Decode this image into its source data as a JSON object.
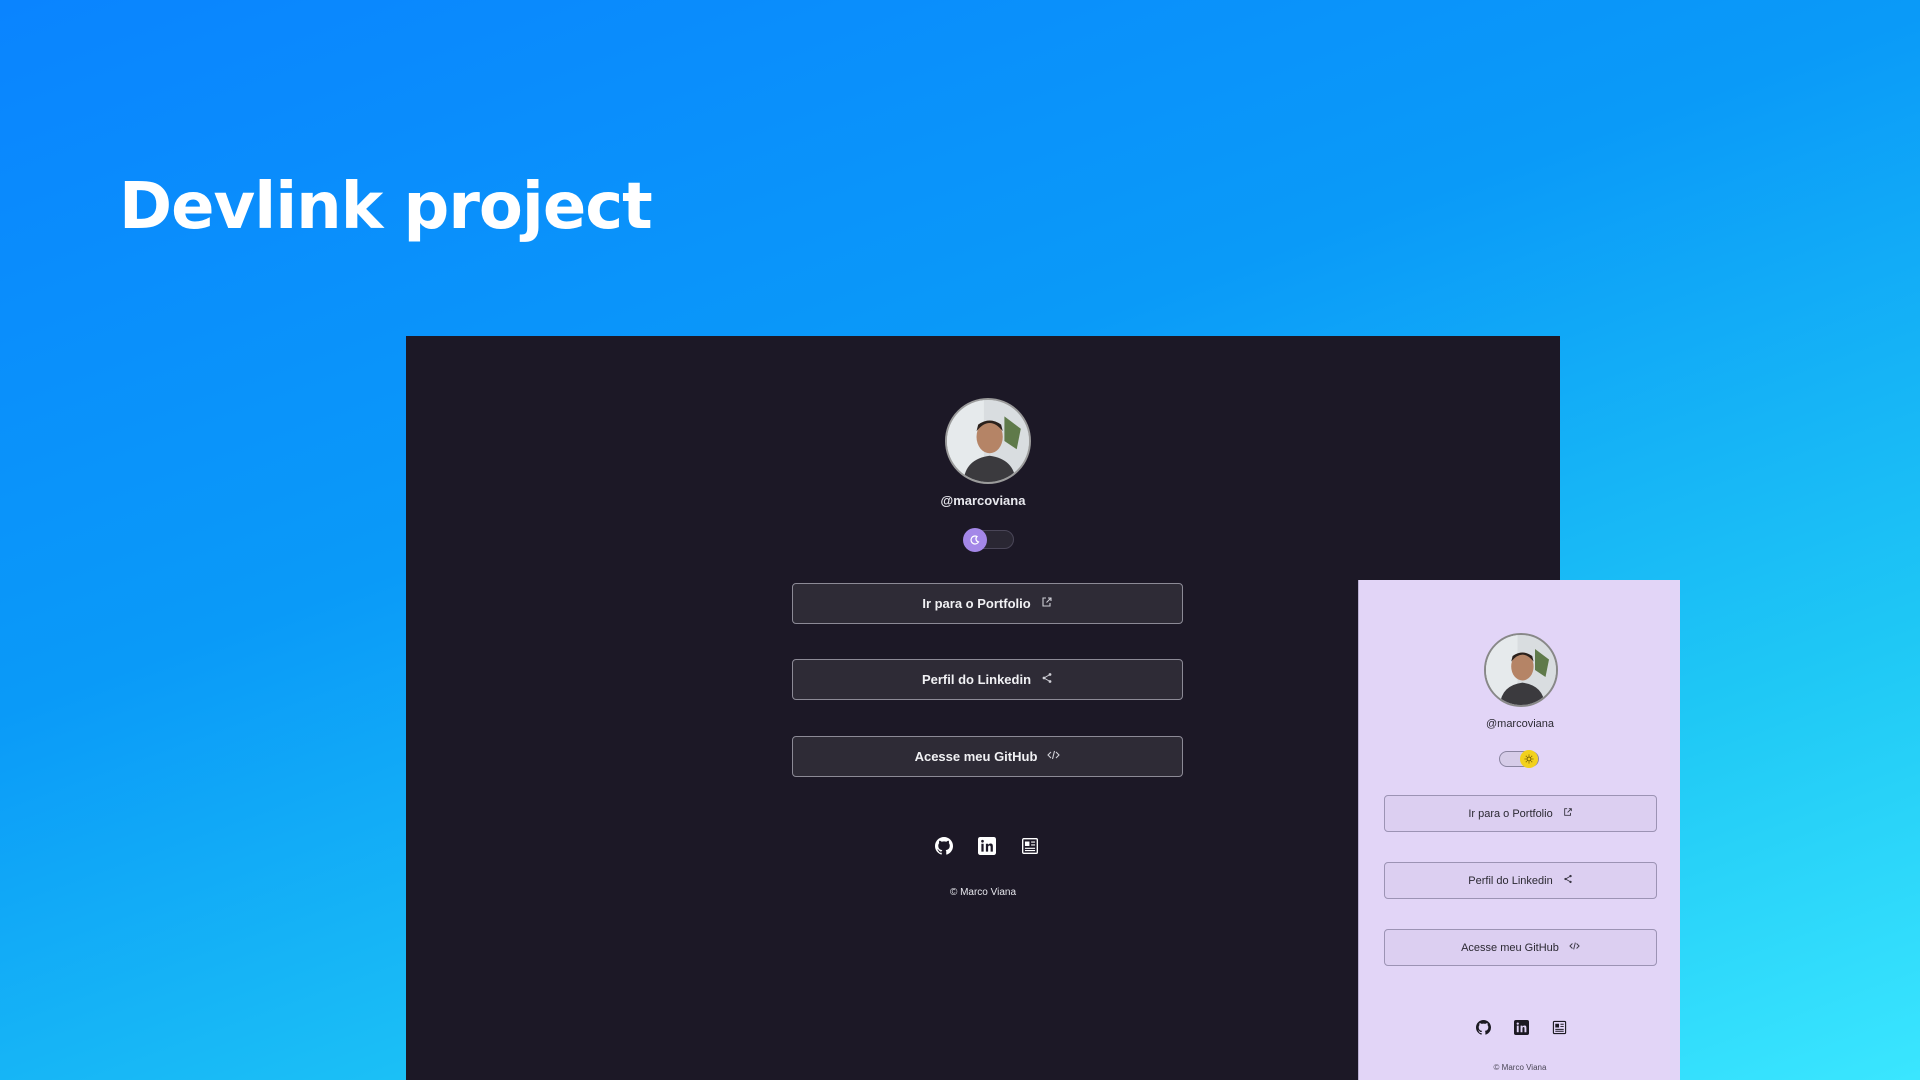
{
  "title": "Devlink project",
  "dark_preview": {
    "handle": "@marcoviana",
    "theme_toggle": "dark",
    "buttons": [
      {
        "label": "Ir para o Portfolio",
        "icon": "external-link-icon"
      },
      {
        "label": "Perfil do Linkedin",
        "icon": "share-icon"
      },
      {
        "label": "Acesse meu GitHub",
        "icon": "code-icon"
      }
    ],
    "social_icons": [
      "github-icon",
      "linkedin-icon",
      "resume-icon"
    ],
    "footer": "© Marco Viana"
  },
  "light_preview": {
    "handle": "@marcoviana",
    "theme_toggle": "light",
    "buttons": [
      {
        "label": "Ir para o Portfolio",
        "icon": "external-link-icon"
      },
      {
        "label": "Perfil do Linkedin",
        "icon": "share-icon"
      },
      {
        "label": "Acesse meu GitHub",
        "icon": "code-icon"
      }
    ],
    "social_icons": [
      "github-icon",
      "linkedin-icon",
      "resume-icon"
    ],
    "footer": "© Marco Viana"
  },
  "colors": {
    "dark_bg": "#1c1826",
    "light_bg": "#e2d5f7",
    "toggle_dark": "#a487e8",
    "toggle_light": "#f2d11c"
  }
}
